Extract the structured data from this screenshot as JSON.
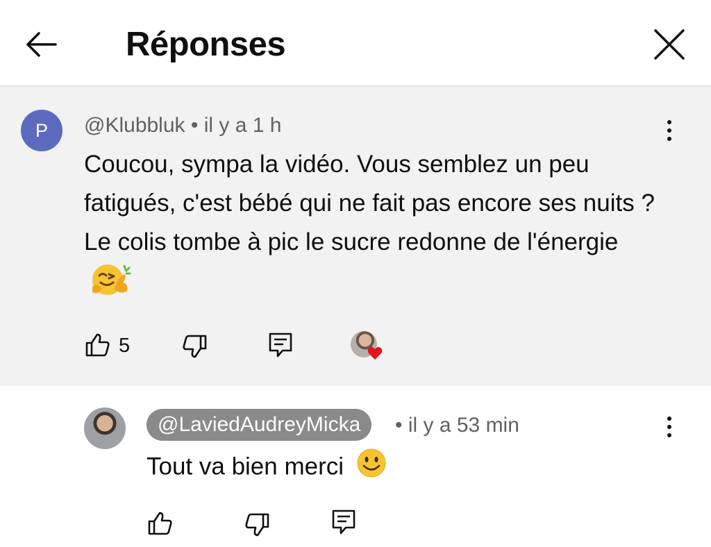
{
  "header": {
    "title": "Réponses",
    "back_icon": "arrow-left-icon",
    "close_icon": "close-icon"
  },
  "comment": {
    "avatar_letter": "P",
    "avatar_color": "#5c6bc0",
    "handle": "@Klubbluk",
    "separator": " • ",
    "time": "il y a 1 h",
    "text": "Coucou, sympa la vidéo. Vous semblez un peu fatigués, c'est bébé qui ne fait pas encore ses nuits ? Le colis tombe à pic le sucre redonne de l'énergie",
    "emoji": "hugging-face-emoji",
    "likes": "5"
  },
  "reply": {
    "handle": "@LaviedAudreyMicka",
    "separator": "• ",
    "time": "il y a 53 min",
    "text": "Tout va bien merci",
    "emoji": "smiling-face-emoji"
  },
  "colors": {
    "comment_background": "#f2f2f2",
    "heart": "#e8121b",
    "handle_badge": "#8a8a8a"
  }
}
